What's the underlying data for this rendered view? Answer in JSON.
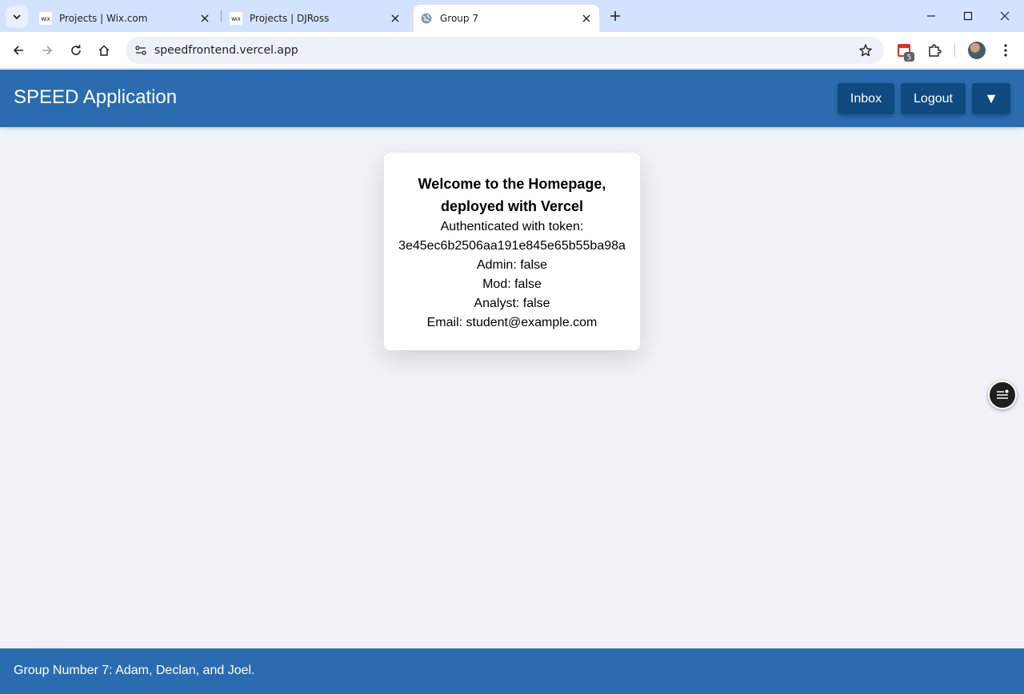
{
  "browser": {
    "tabs": [
      {
        "title": "Projects | Wix.com",
        "favicon": "wix-logo-icon"
      },
      {
        "title": "Projects | DJRoss",
        "favicon": "wix-logo-icon"
      },
      {
        "title": "Group 7",
        "favicon": "globe-icon",
        "active": true
      }
    ],
    "url": "speedfrontend.vercel.app",
    "extension_badge_count": "5",
    "favicon_wix_text": "WiX"
  },
  "app": {
    "title": "SPEED Application",
    "buttons": {
      "inbox": "Inbox",
      "logout": "Logout",
      "menu": "▼"
    }
  },
  "welcome_card": {
    "heading": "Welcome to the Homepage, deployed with Vercel",
    "token_label": "Authenticated with token:",
    "token": "3e45ec6b2506aa191e845e65b55ba98a",
    "admin": "Admin: false",
    "mod": "Mod: false",
    "analyst": "Analyst: false",
    "email": "Email: student@example.com"
  },
  "footer": {
    "text": "Group Number 7: Adam, Declan, and Joel."
  },
  "colors": {
    "header_bg": "#2b6cb0",
    "button_bg": "#0f4a80",
    "page_bg": "#eff3f8",
    "tabstrip_bg": "#d3e3fd"
  }
}
